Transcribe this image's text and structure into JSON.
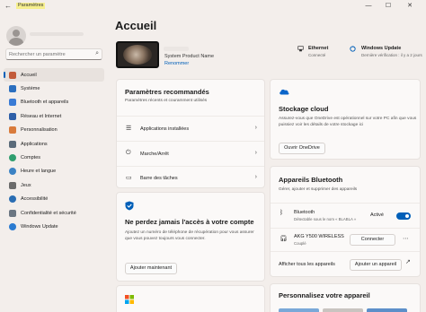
{
  "window": {
    "title": "Paramètres",
    "back_glyph": "←",
    "controls": [
      "—",
      "☐",
      "✕"
    ]
  },
  "sidebar": {
    "search_placeholder": "Rechercher un paramètre",
    "items": [
      {
        "label": "Accueil",
        "icon": "home-icon",
        "color": "#c25b3a",
        "active": true
      },
      {
        "label": "Système",
        "icon": "system-icon",
        "color": "#2b6fbf"
      },
      {
        "label": "Bluetooth et appareils",
        "icon": "bluetooth-devices-icon",
        "color": "#3a7bd5"
      },
      {
        "label": "Réseau et Internet",
        "icon": "network-icon",
        "color": "#2e5fa8"
      },
      {
        "label": "Personnalisation",
        "icon": "brush-icon",
        "color": "#d97b3c"
      },
      {
        "label": "Applications",
        "icon": "apps-icon",
        "color": "#5b6b7a"
      },
      {
        "label": "Comptes",
        "icon": "accounts-icon",
        "color": "#2f9e6e"
      },
      {
        "label": "Heure et langue",
        "icon": "time-language-icon",
        "color": "#3b82c4"
      },
      {
        "label": "Jeux",
        "icon": "gaming-icon",
        "color": "#6b6b6b"
      },
      {
        "label": "Accessibilité",
        "icon": "accessibility-icon",
        "color": "#2a6db3"
      },
      {
        "label": "Confidentialité et sécurité",
        "icon": "shield-icon",
        "color": "#6b7682"
      },
      {
        "label": "Windows Update",
        "icon": "windows-update-icon",
        "color": "#2b7bd1"
      }
    ]
  },
  "main": {
    "title": "Accueil",
    "device": {
      "product_name": "System Product Name",
      "rename_label": "Renommer"
    },
    "status": {
      "ethernet": {
        "title": "Ethernet",
        "subtitle": "Connecté"
      },
      "update": {
        "title": "Windows Update",
        "subtitle": "Dernière vérification : il y a 2 jours"
      }
    },
    "recommended": {
      "title": "Paramètres recommandés",
      "subtitle": "Paramètres récents et couramment utilisés",
      "rows": [
        {
          "label": "Applications installées",
          "icon": "apps-list-icon"
        },
        {
          "label": "Marche/Arrêt",
          "icon": "power-icon"
        },
        {
          "label": "Barre des tâches",
          "icon": "taskbar-icon"
        }
      ]
    },
    "account": {
      "title": "Ne perdez jamais l'accès à votre compte",
      "body": "Ajoutez un numéro de téléphone de récupération pour vous assurer que vous pouvez toujours vous connecter.",
      "button": "Ajouter maintenant"
    },
    "cloud": {
      "title": "Stockage cloud",
      "body": "Assurez-vous que OneDrive est opérationnel sur votre PC afin que vous puissiez voir les détails de votre stockage ici",
      "button": "Ouvrir OneDrive"
    },
    "bluetooth": {
      "title": "Appareils Bluetooth",
      "subtitle": "Gérer, ajouter et supprimer des appareils",
      "bt_label": "Bluetooth",
      "bt_sub": "Détectable sous le nom « BLABLA »",
      "bt_state": "Activé",
      "device_name": "AKG Y500 WIRELESS",
      "device_status": "Couplé",
      "connect_button": "Connecter",
      "show_all": "Afficher tous les appareils",
      "add_button": "Ajouter un appareil"
    },
    "personalize": {
      "title": "Personnalisez votre appareil"
    }
  }
}
